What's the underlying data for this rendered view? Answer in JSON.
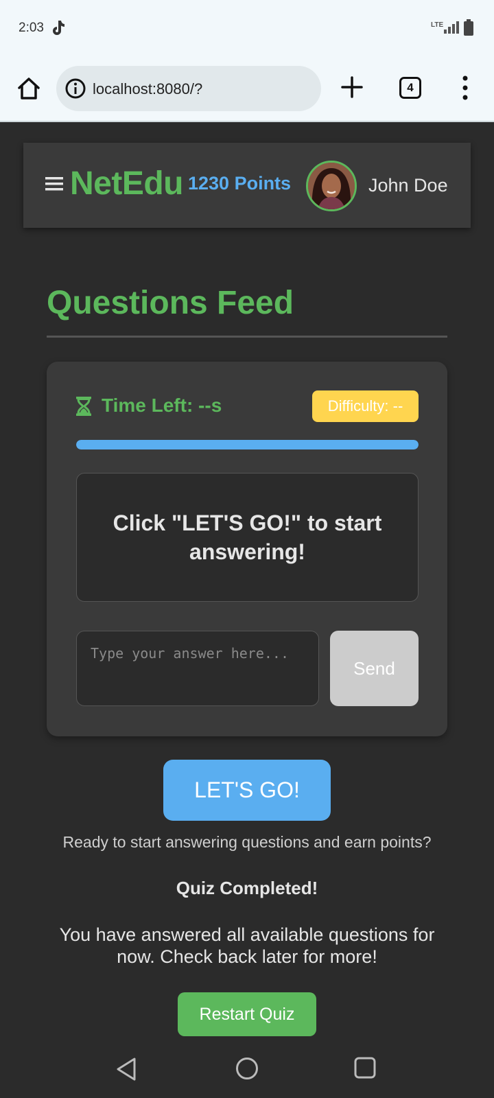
{
  "status_bar": {
    "time": "2:03",
    "network": "LTE",
    "icons": [
      "tiktok-icon",
      "signal-icon",
      "battery-icon"
    ]
  },
  "browser": {
    "url": "localhost:8080/?",
    "tab_count": "4",
    "icons": [
      "home-icon",
      "info-icon",
      "plus-icon",
      "tabs-icon",
      "more-vert-icon"
    ]
  },
  "header": {
    "logo": "NetEdu",
    "points": "1230 Points",
    "user_name": "John Doe"
  },
  "main": {
    "title": "Questions Feed",
    "quiz": {
      "time_left": "Time Left: --s",
      "difficulty": "Difficulty: --",
      "progress": 1.0,
      "question": "Click \"LET'S GO!\" to start answering!",
      "answer_placeholder": "Type your answer here...",
      "answer_value": "",
      "send_label": "Send"
    },
    "lets_go_label": "LET'S GO!",
    "ready_text": "Ready to start answering questions and earn points?",
    "completed_title": "Quiz Completed!",
    "completed_text": "You have answered all available questions for now. Check back later for more!",
    "restart_label": "Restart Quiz"
  },
  "colors": {
    "background": "#2b2b2b",
    "card": "#3a3a3a",
    "brand_green": "#5cb85c",
    "accent_blue": "#5aaef0",
    "difficulty_yellow": "#ffd54f",
    "disabled_gray": "#cccccc"
  },
  "nav_bar": {
    "icons": [
      "back-icon",
      "home-circle-icon",
      "recents-icon"
    ]
  }
}
